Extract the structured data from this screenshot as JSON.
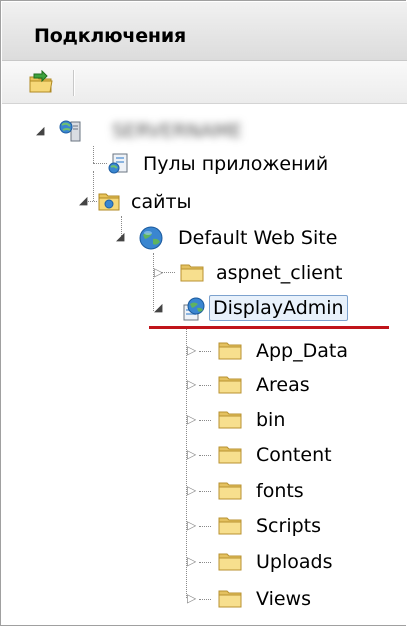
{
  "panel": {
    "title": "Подключения"
  },
  "toolbar": {
    "connect_icon": "connect-folder-icon"
  },
  "tree": {
    "server": {
      "label": "SERVERNAME",
      "icon": "server-icon"
    },
    "app_pools": {
      "label": "Пулы приложений",
      "icon": "app-pools-icon"
    },
    "sites": {
      "label": "сайты",
      "icon": "sites-folder-icon"
    },
    "default_site": {
      "label": "Default Web Site",
      "icon": "globe-icon"
    },
    "aspnet_client": {
      "label": "aspnet_client",
      "icon": "folder-icon"
    },
    "display_admin": {
      "label": "DisplayAdmin",
      "icon": "web-app-icon"
    },
    "children": [
      {
        "label": "App_Data"
      },
      {
        "label": "Areas"
      },
      {
        "label": "bin"
      },
      {
        "label": "Content"
      },
      {
        "label": "fonts"
      },
      {
        "label": "Scripts"
      },
      {
        "label": "Uploads"
      },
      {
        "label": "Views"
      }
    ]
  },
  "colors": {
    "accent_underline": "#c0141a",
    "selection_border": "#7da2ce",
    "selection_fill": "#e8f1fb"
  }
}
